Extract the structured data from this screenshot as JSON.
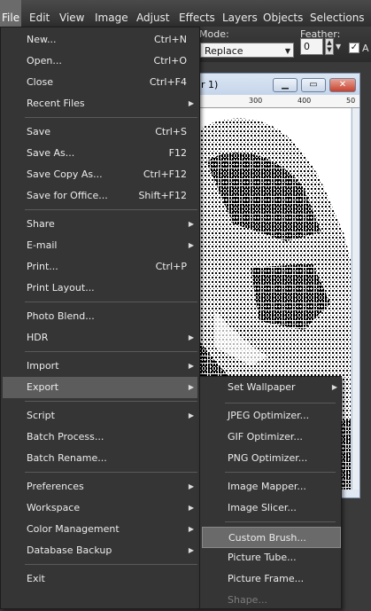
{
  "menubar": {
    "items": [
      "File",
      "Edit",
      "View",
      "Image",
      "Adjust",
      "Effects",
      "Layers",
      "Objects",
      "Selections"
    ]
  },
  "options": {
    "mode_label": "Mode:",
    "mode_value": "Replace",
    "feather_label": "Feather:",
    "feather_value": "0",
    "antialias_label": "A",
    "antialias_checked": true
  },
  "document": {
    "title": "r 1)",
    "ruler_ticks": [
      "300",
      "400",
      "50"
    ]
  },
  "file_menu": {
    "items": [
      {
        "label": "New...",
        "accel": "Ctrl+N"
      },
      {
        "label": "Open...",
        "accel": "Ctrl+O"
      },
      {
        "label": "Close",
        "accel": "Ctrl+F4"
      },
      {
        "label": "Recent Files",
        "submenu": true
      },
      {
        "label": "Save",
        "accel": "Ctrl+S"
      },
      {
        "label": "Save As...",
        "accel": "F12"
      },
      {
        "label": "Save Copy As...",
        "accel": "Ctrl+F12"
      },
      {
        "label": "Save for Office...",
        "accel": "Shift+F12"
      },
      {
        "label": "Share",
        "submenu": true
      },
      {
        "label": "E-mail",
        "submenu": true
      },
      {
        "label": "Print...",
        "accel": "Ctrl+P"
      },
      {
        "label": "Print Layout..."
      },
      {
        "label": "Photo Blend..."
      },
      {
        "label": "HDR",
        "submenu": true
      },
      {
        "label": "Import",
        "submenu": true
      },
      {
        "label": "Export",
        "submenu": true,
        "highlighted": true
      },
      {
        "label": "Script",
        "submenu": true
      },
      {
        "label": "Batch Process..."
      },
      {
        "label": "Batch Rename..."
      },
      {
        "label": "Preferences",
        "submenu": true
      },
      {
        "label": "Workspace",
        "submenu": true
      },
      {
        "label": "Color Management",
        "submenu": true
      },
      {
        "label": "Database Backup",
        "submenu": true
      },
      {
        "label": "Exit"
      }
    ]
  },
  "export_menu": {
    "items": [
      {
        "label": "Set Wallpaper",
        "submenu": true
      },
      {
        "label": "JPEG Optimizer..."
      },
      {
        "label": "GIF Optimizer..."
      },
      {
        "label": "PNG Optimizer..."
      },
      {
        "label": "Image Mapper..."
      },
      {
        "label": "Image Slicer..."
      },
      {
        "label": "Custom Brush...",
        "highlighted": true
      },
      {
        "label": "Picture Tube..."
      },
      {
        "label": "Picture Frame..."
      },
      {
        "label": "Shape...",
        "disabled": true
      }
    ]
  },
  "colors": {
    "menu_bg": "#353535",
    "highlight": "#5c5c5c",
    "doc_title_bg": "#c5d5ea",
    "close_button": "#c8412e"
  }
}
